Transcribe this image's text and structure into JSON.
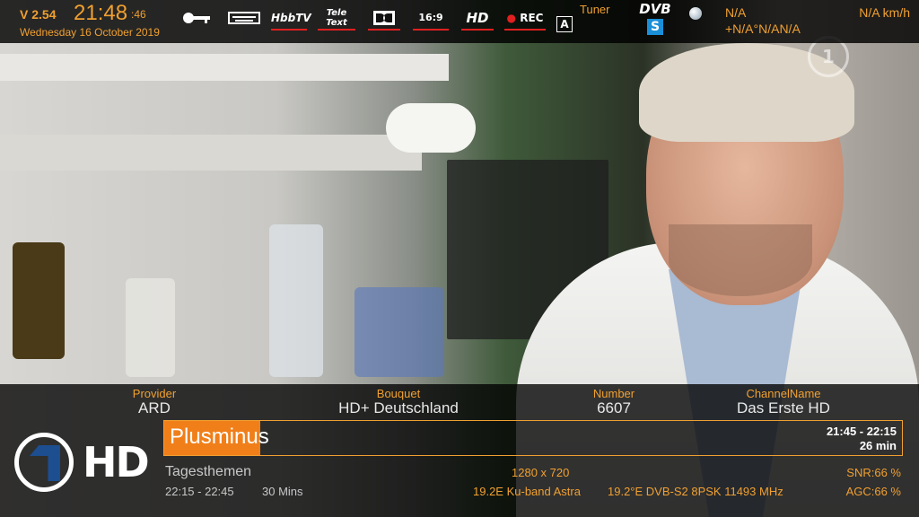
{
  "topbar": {
    "version": "V 2.54",
    "time": "21:48",
    "seconds": ":46",
    "date": "Wednesday 16 October 2019",
    "icons": {
      "key": "key-icon",
      "keyboard": "keyboard-icon",
      "hbbtv": "HbbTV",
      "teletext": "Tele Text",
      "dolby": "dolby-icon",
      "aspect": "16:9",
      "hd": "HD",
      "rec": "REC",
      "audio": "A"
    },
    "tuner_label": "Tuner",
    "dvb_top": "DVB",
    "dvb_bottom": "S",
    "na1": "N/A",
    "na2": "+N/A°N/AN/A",
    "speed": "N/A km/h"
  },
  "video": {
    "watermark": "1"
  },
  "info": {
    "provider_label": "Provider",
    "provider_value": "ARD",
    "bouquet_label": "Bouquet",
    "bouquet_value": "HD+ Deutschland",
    "number_label": "Number",
    "number_value": "6607",
    "channelname_label": "ChannelName",
    "channelname_value": "Das Erste HD",
    "current_program": "Plusminus",
    "current_time": "21:45  -  22:15",
    "current_duration": "26 min",
    "progress_fraction": 0.13,
    "next_program": "Tagesthemen",
    "next_time": "22:15  -  22:45",
    "next_duration": "30 Mins",
    "resolution": "1280 x 720",
    "satellite": "19.2E Ku-band Astra",
    "transponder": "19.2°E DVB-S2 8PSK 11493 MHz",
    "snr": "SNR:66 %",
    "agc": "AGC:66 %",
    "logo_text": "HD"
  },
  "colors": {
    "accent": "#f0a030",
    "progress": "#f07f1a",
    "rec": "#e02020",
    "dvb_blue": "#1a8fd8"
  }
}
